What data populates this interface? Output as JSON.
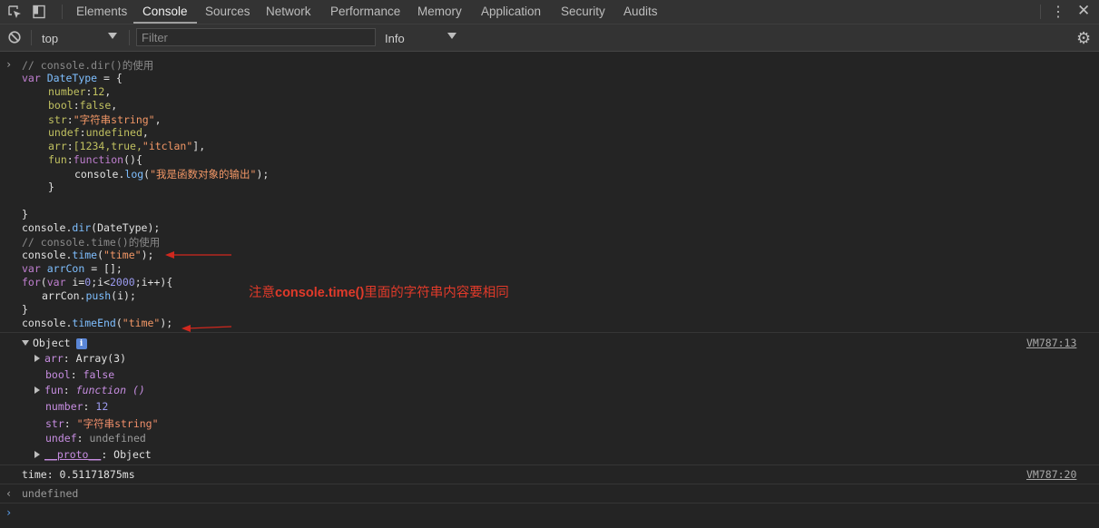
{
  "tabs": [
    "Elements",
    "Console",
    "Sources",
    "Network",
    "Performance",
    "Memory",
    "Application",
    "Security",
    "Audits"
  ],
  "toolbar": {
    "context": "top",
    "filter_placeholder": "Filter",
    "level": "Info"
  },
  "code": {
    "l1": "// console.dir()的使用",
    "l2_kw": "var",
    "l2_id": "DateType",
    "l2_rest": " = {",
    "number_key": "number",
    "number_val": "12",
    "bool_key": "bool",
    "bool_val": "false",
    "str_key": "str",
    "str_val": "\"字符串string\"",
    "undef_key": "undef",
    "undef_val": "undefined",
    "arr_key": "arr",
    "arr_val_a": "[1234,true,",
    "arr_val_b": "\"itclan\"",
    "arr_val_c": "],",
    "fun_key": "fun",
    "fun_val": "function",
    "fun_rest": "(){",
    "log_a": "console.",
    "log_b": "log",
    "log_c": "(",
    "log_str": "\"我是函数对象的输出\"",
    "log_d": ");",
    "close_inner": "}",
    "close_outer": "}",
    "dir_a": "console.",
    "dir_b": "dir",
    "dir_c": "(DateType);",
    "l_cm2": "// console.time()的使用",
    "time_a": "console.",
    "time_b": "time",
    "time_c": "(",
    "time_str": "\"time\"",
    "time_d": ");",
    "arr_decl_kw": "var",
    "arr_decl_id": "arrCon",
    "arr_decl_rest": " = [];",
    "for_kw": "for",
    "for_a": "(",
    "for_var": "var",
    "for_b": " i=",
    "for_n0": "0",
    "for_c": ";i<",
    "for_n2000": "2000",
    "for_d": ";i++){",
    "push_a": "arrCon.",
    "push_b": "push",
    "push_c": "(i);",
    "for_close": "}",
    "end_a": "console.",
    "end_b": "timeEnd",
    "end_c": "(",
    "end_str": "\"time\"",
    "end_d": ");"
  },
  "annotation": {
    "prefix": "注意",
    "bold": "console.time()",
    "suffix": "里面的字符串内容要相同"
  },
  "output": {
    "object_label": "Object",
    "info_icon": "i",
    "vm1": "VM787:13",
    "props": [
      {
        "key": "arr",
        "value": "Array(3)"
      },
      {
        "key": "bool",
        "value": "false"
      },
      {
        "key": "fun",
        "value": "function ()"
      },
      {
        "key": "number",
        "value": "12"
      },
      {
        "key": "str",
        "value": "\"字符串string\""
      },
      {
        "key": "undef",
        "value": "undefined"
      },
      {
        "key": "__proto__",
        "value": "Object"
      }
    ],
    "time_line": "time: 0.51171875ms",
    "vm2": "VM787:20",
    "undefined": "undefined"
  },
  "icons": [
    "inspect-icon",
    "device-toolbar-icon",
    "kebab-menu-icon",
    "close-icon",
    "clear-console-icon",
    "gear-icon",
    "prompt-chevron-icon",
    "return-arrow-icon"
  ]
}
